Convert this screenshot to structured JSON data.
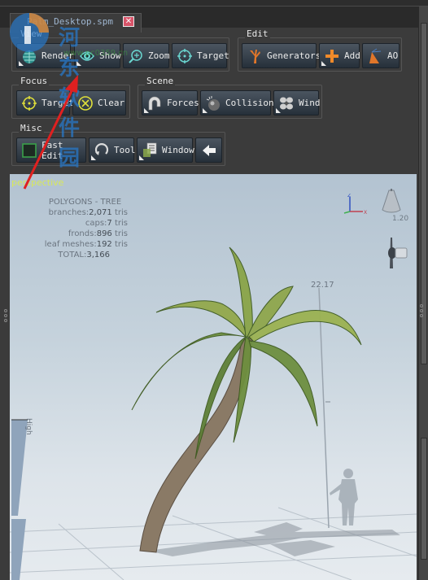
{
  "tab": {
    "title": "Palm_Desktop.spm",
    "close_icon": "close-icon"
  },
  "groups": {
    "view": {
      "label": "View",
      "buttons": [
        {
          "label": "Render",
          "icon": "render-globe-icon"
        },
        {
          "label": "Show",
          "icon": "eye-icon"
        },
        {
          "label": "Zoom",
          "icon": "zoom-icon"
        },
        {
          "label": "Target",
          "icon": "target-icon"
        }
      ]
    },
    "edit": {
      "label": "Edit",
      "buttons": [
        {
          "label": "Generators",
          "icon": "generators-icon"
        },
        {
          "label": "Add",
          "icon": "plus-icon"
        },
        {
          "label": "AO",
          "icon": "ao-icon"
        }
      ]
    },
    "focus": {
      "label": "Focus",
      "buttons": [
        {
          "label": "Target",
          "icon": "focus-target-icon"
        },
        {
          "label": "Clear",
          "icon": "clear-icon"
        }
      ]
    },
    "scene": {
      "label": "Scene",
      "buttons": [
        {
          "label": "Forces",
          "icon": "magnet-icon"
        },
        {
          "label": "Collision",
          "icon": "collision-icon"
        },
        {
          "label": "Wind",
          "icon": "fan-icon"
        }
      ]
    },
    "misc": {
      "label": "Misc",
      "buttons": [
        {
          "label": "Fast Edit",
          "icon": "fast-edit-icon"
        },
        {
          "label": "Tool",
          "icon": "tool-icon"
        },
        {
          "label": "Window",
          "icon": "window-icon"
        },
        {
          "label": "",
          "icon": "back-arrow-icon"
        }
      ]
    }
  },
  "viewport": {
    "label": "perspective",
    "stats": {
      "title": "POLYGONS - TREE",
      "rows": [
        {
          "key": "branches:",
          "value": "2,071",
          "unit": " tris"
        },
        {
          "key": "caps:",
          "value": "7",
          "unit": " tris"
        },
        {
          "key": "fronds:",
          "value": "896",
          "unit": " tris"
        },
        {
          "key": "leaf meshes:",
          "value": "192",
          "unit": " tris"
        },
        {
          "key": "TOTAL:",
          "value": "3,166",
          "unit": ""
        }
      ]
    },
    "axis": {
      "z": "Z",
      "x": "X"
    },
    "light_value": "1.20",
    "height_value": "22.17",
    "high_label": "High"
  },
  "watermark": {
    "text": "河东软件园",
    "url": "www.pc0359.cn"
  },
  "colors": {
    "button_top": "#4b5560",
    "button_bottom": "#26303a",
    "viewport_label": "#d8e85a",
    "tab_text": "#9fb6d0",
    "annotation_arrow": "#e02020"
  }
}
